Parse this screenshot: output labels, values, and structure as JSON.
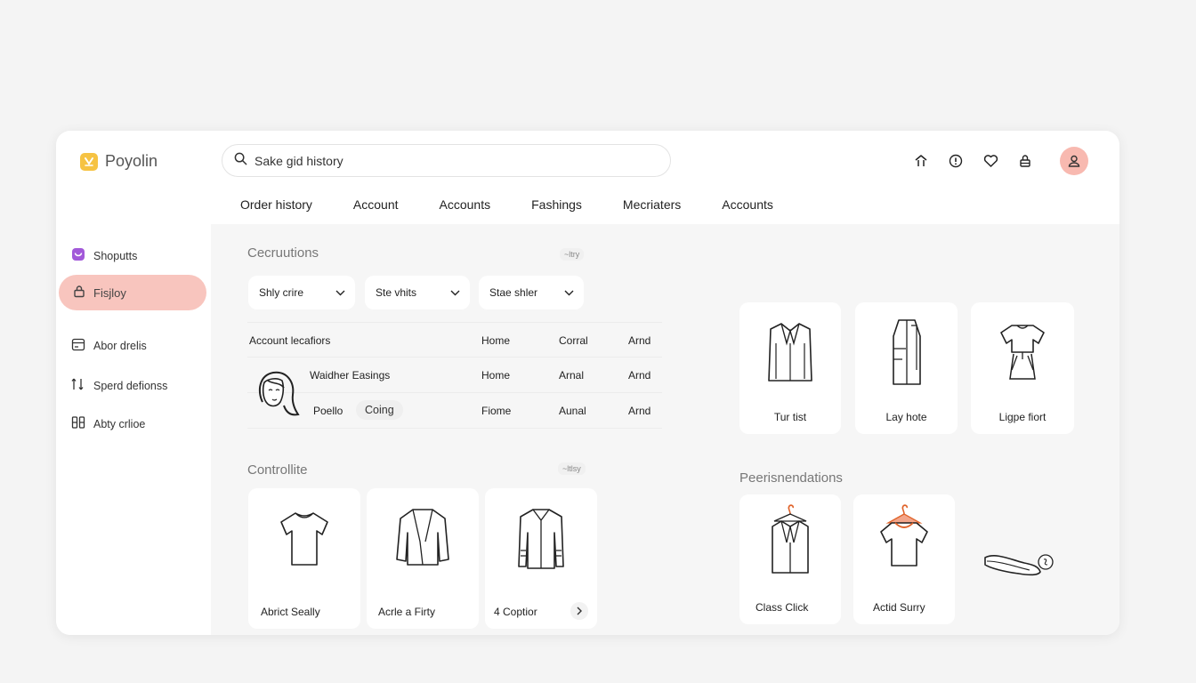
{
  "app": {
    "name": "Poyolin",
    "search_value": "Sake gid history"
  },
  "nav": {
    "tabs": [
      "Order history",
      "Account",
      "Accounts",
      "Fashings",
      "Mecriaters",
      "Accounts"
    ]
  },
  "sidebar": {
    "items": [
      {
        "label": "Shoputts",
        "icon": "bag-icon"
      },
      {
        "label": "Fisjloy",
        "icon": "lock-icon",
        "active": true
      },
      {
        "label": "Abor drelis",
        "icon": "card-icon"
      },
      {
        "label": "Sperd defionss",
        "icon": "transfer-icon"
      },
      {
        "label": "Abty crlioe",
        "icon": "columns-icon"
      }
    ]
  },
  "sections": {
    "collections": {
      "title": "Cecruutions",
      "tag": "~ltry",
      "filters": [
        "Shly crire",
        "Ste vhits",
        "Stae shler"
      ],
      "table": {
        "header": [
          "Account lecafiors",
          "Home",
          "Corral",
          "Arnd"
        ],
        "rows": [
          [
            "Waidher Easings",
            "Home",
            "Arnal",
            "Arnd"
          ],
          [
            "Poello",
            "Coing",
            "Fiome",
            "Aunal",
            "Arnd"
          ]
        ]
      }
    },
    "featured": {
      "cards": [
        "Tur tist",
        "Lay hote",
        "Ligpe fiort"
      ]
    },
    "controlite": {
      "title": "Controllite",
      "tag": "~ltlsy",
      "cards": [
        "Abrict Seally",
        "Acrle a Firty",
        "4 Coptior"
      ]
    },
    "recommendations": {
      "title": "Peerisnendations",
      "cards": [
        "Class Click",
        "Actid Surry"
      ]
    }
  },
  "colors": {
    "accent_pink": "#f8c5be",
    "logo_yellow": "#f6c343",
    "sidebar_icon_purple": "#a259d9"
  }
}
